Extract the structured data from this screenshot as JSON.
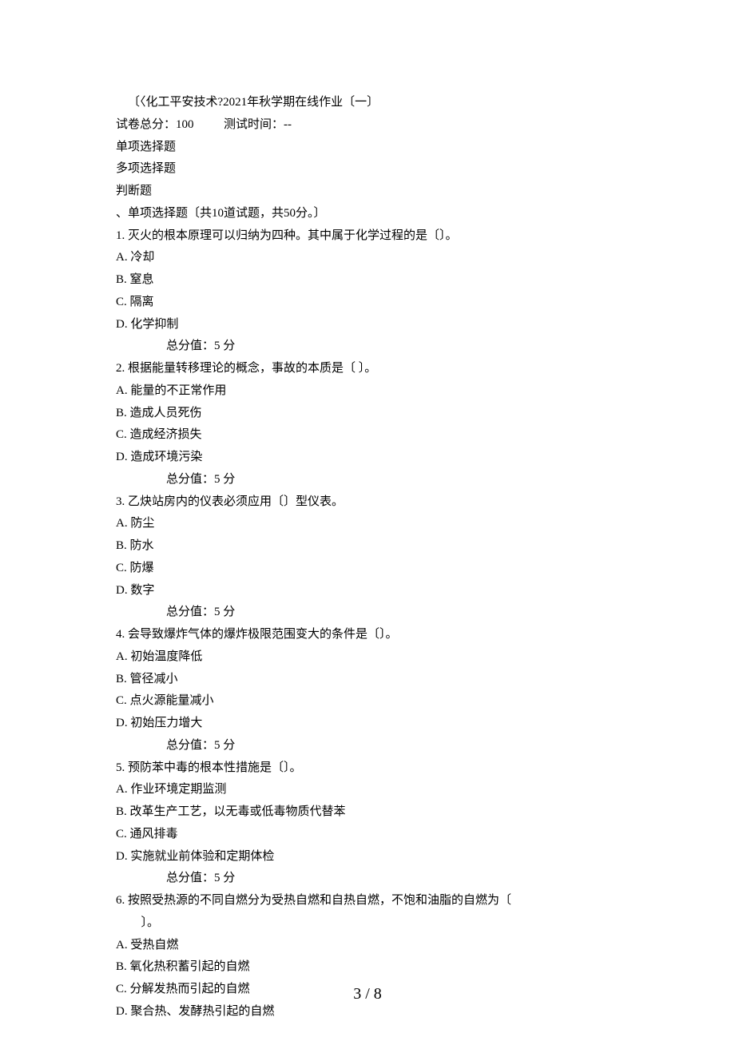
{
  "header": {
    "title": "〔〈化工平安技术?2021年秋学期在线作业〔一〕",
    "total_score_line": "试卷总分：100          测试时间：--",
    "sections": [
      "单项选择题",
      "多项选择题",
      "判断题"
    ],
    "section1_header": "、单项选择题〔共10道试题，共50分。〕"
  },
  "questions": [
    {
      "num": "1.",
      "stem": "灭火的根本原理可以归纳为四种。其中属于化学过程的是〔〕。",
      "opts": [
        "冷却",
        "窒息",
        "隔离",
        "化学抑制"
      ],
      "score": "总分值：5 分"
    },
    {
      "num": "2.",
      "stem": "根据能量转移理论的概念，事故的本质是〔     〕。",
      "opts": [
        "能量的不正常作用",
        "造成人员死伤",
        "造成经济损失",
        "造成环境污染"
      ],
      "score": "总分值：5 分"
    },
    {
      "num": "3.",
      "stem": "乙炔站房内的仪表必须应用〔〕型仪表。",
      "opts": [
        "防尘",
        "防水",
        "防爆",
        "数字"
      ],
      "score": "总分值：5 分"
    },
    {
      "num": "4.",
      "stem": "会导致爆炸气体的爆炸极限范围变大的条件是〔〕。",
      "opts": [
        "初始温度降低",
        "管径减小",
        "点火源能量减小",
        "初始压力增大"
      ],
      "score": "总分值：5 分"
    },
    {
      "num": "5.",
      "stem": "预防苯中毒的根本性措施是〔〕。",
      "opts": [
        "作业环境定期监测",
        "改革生产工艺，以无毒或低毒物质代替苯",
        "通风排毒",
        "实施就业前体验和定期体检"
      ],
      "score": "总分值：5 分"
    },
    {
      "num": "6.",
      "stem_line1": "按照受热源的不同自燃分为受热自燃和自热自燃，不饱和油脂的自燃为〔",
      "stem_line2": "〕。",
      "opts": [
        "受热自燃",
        "氧化热积蓄引起的自燃",
        "分解发热而引起的自燃",
        "聚合热、发酵热引起的自燃"
      ]
    }
  ],
  "opt_labels": [
    "A.",
    "B.",
    "C.",
    "D."
  ],
  "footer": {
    "page": "3 / 8"
  }
}
